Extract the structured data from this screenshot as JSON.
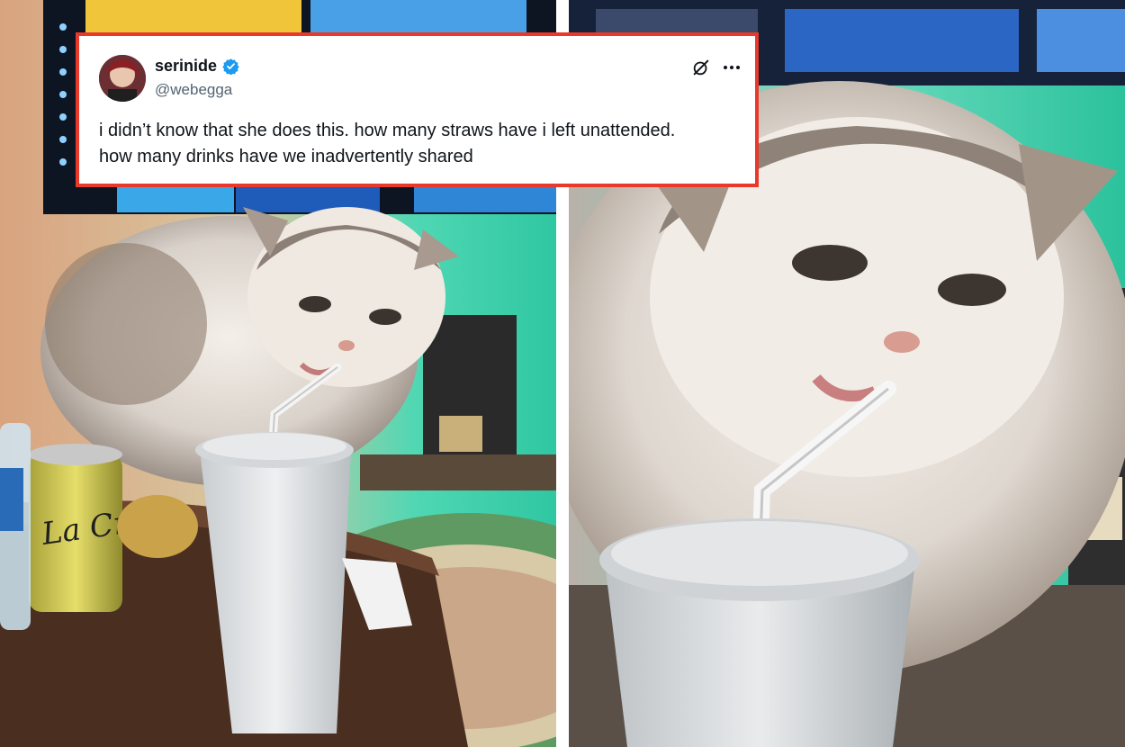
{
  "tweet": {
    "display_name": "serinide",
    "handle": "@webegga",
    "text_line1": "i didn’t know that she does this. how many straws have i left unattended.",
    "text_line2": "how many drinks have we inadvertently shared",
    "icons": {
      "avatar": "avatar-image",
      "verified": "verified-badge-icon",
      "grok": "grok-icon",
      "more": "more-options-icon"
    },
    "colors": {
      "frame_border": "#e8392b",
      "verified_blue": "#1d9bf0",
      "text": "#0f1419",
      "handle": "#536471"
    }
  },
  "photos": {
    "left": {
      "subject": "cat drinking from straw, wide shot",
      "can_text": "La Croix"
    },
    "right": {
      "subject": "cat drinking from straw, close-up"
    }
  }
}
